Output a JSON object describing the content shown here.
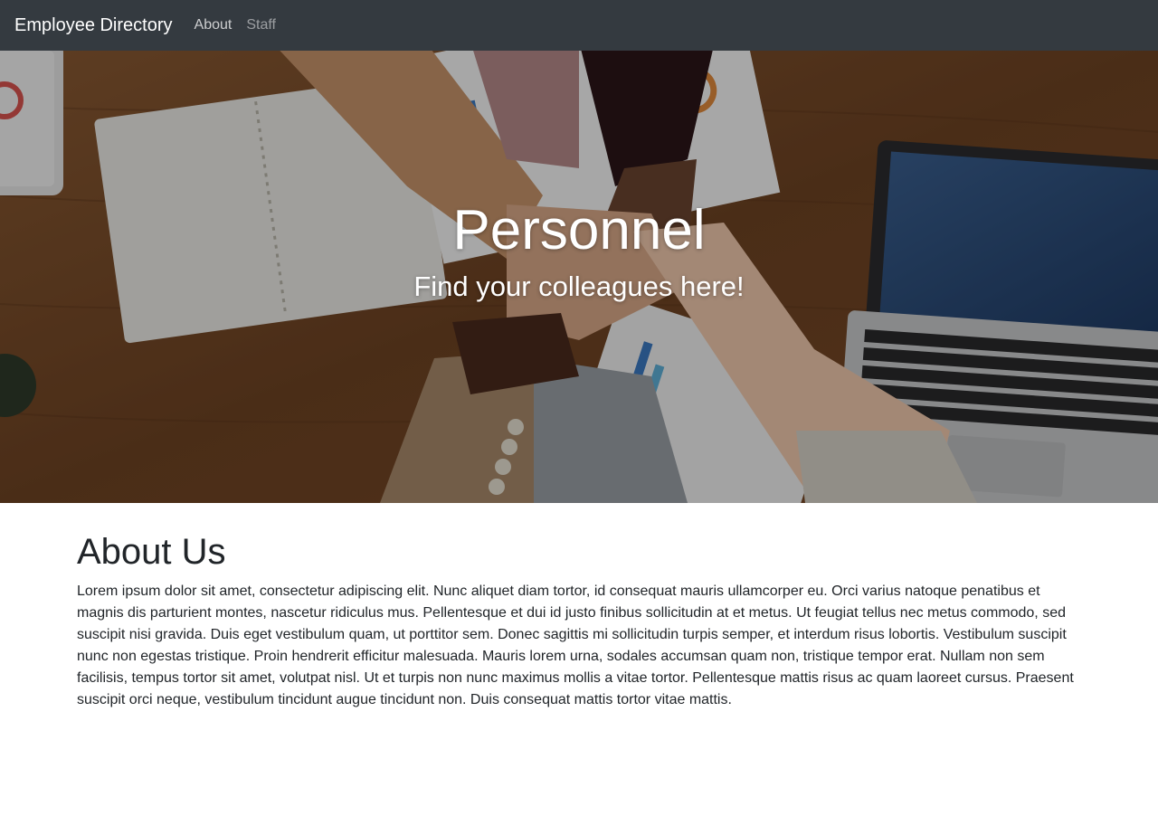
{
  "navbar": {
    "brand": "Employee Directory",
    "links": [
      {
        "label": "About"
      },
      {
        "label": "Staff"
      }
    ],
    "background": "#343a40"
  },
  "hero": {
    "title": "Personnel",
    "subtitle": "Find your colleagues here!"
  },
  "about": {
    "heading": "About Us",
    "body": "Lorem ipsum dolor sit amet, consectetur adipiscing elit. Nunc aliquet diam tortor, id consequat mauris ullamcorper eu. Orci varius natoque penatibus et magnis dis parturient montes, nascetur ridiculus mus. Pellentesque et dui id justo finibus sollicitudin at et metus. Ut feugiat tellus nec metus commodo, sed suscipit nisi gravida. Duis eget vestibulum quam, ut porttitor sem. Donec sagittis mi sollicitudin turpis semper, et interdum risus lobortis. Vestibulum suscipit nunc non egestas tristique. Proin hendrerit efficitur malesuada. Mauris lorem urna, sodales accumsan quam non, tristique tempor erat. Nullam non sem facilisis, tempus tortor sit amet, volutpat nisl. Ut et turpis non nunc maximus mollis a vitae tortor. Pellentesque mattis risus ac quam laoreet cursus. Praesent suscipit orci neque, vestibulum tincidunt augue tincidunt non. Duis consequat mattis tortor vitae mattis."
  }
}
